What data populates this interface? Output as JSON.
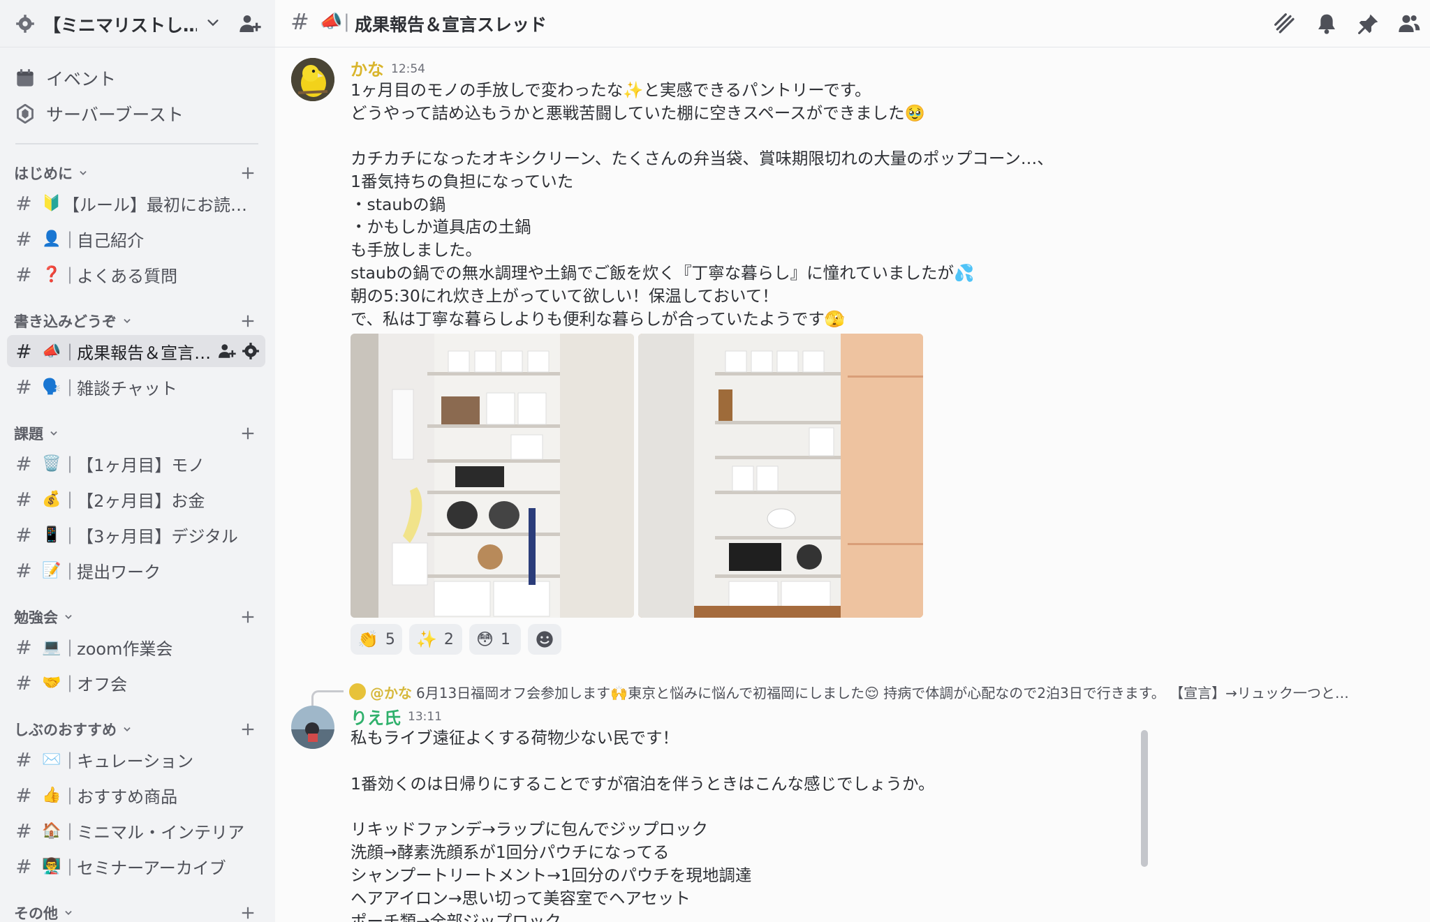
{
  "colors": {
    "sidebar_bg": "#f2f3f5",
    "main_bg": "#fbfbfb",
    "username_kana": "#d9b52c",
    "username_rie": "#2fb06b",
    "mention": "#d6b83b"
  },
  "server": {
    "name": "【ミニマリストし…"
  },
  "sidebar": {
    "top_items": [
      {
        "icon": "calendar-icon",
        "label": "イベント"
      },
      {
        "icon": "boost-icon",
        "label": "サーバーブースト"
      }
    ],
    "categories": [
      {
        "name": "はじめに",
        "channels": [
          {
            "emoji": "🔰",
            "label": "【ルール】最初にお読…"
          },
          {
            "emoji": "👤",
            "label": "自己紹介"
          },
          {
            "emoji": "❓",
            "label": "よくある質問"
          }
        ]
      },
      {
        "name": "書き込みどうぞ",
        "channels": [
          {
            "emoji": "📣",
            "label": "成果報告＆宣言…",
            "active": true
          },
          {
            "emoji": "🗣️",
            "label": "雑談チャット"
          }
        ]
      },
      {
        "name": "課題",
        "channels": [
          {
            "emoji": "🗑️",
            "label": "【1ヶ月目】モノ"
          },
          {
            "emoji": "💰",
            "label": "【2ヶ月目】お金"
          },
          {
            "emoji": "📱",
            "label": "【3ヶ月目】デジタル"
          },
          {
            "emoji": "📝",
            "label": "提出ワーク"
          }
        ]
      },
      {
        "name": "勉強会",
        "channels": [
          {
            "emoji": "💻",
            "label": "zoom作業会"
          },
          {
            "emoji": "🤝",
            "label": "オフ会"
          }
        ]
      },
      {
        "name": "しぶのおすすめ",
        "channels": [
          {
            "emoji": "✉️",
            "label": "キュレーション"
          },
          {
            "emoji": "👍",
            "label": "おすすめ商品"
          },
          {
            "emoji": "🏠",
            "label": "ミニマル・インテリア"
          },
          {
            "emoji": "👨‍🏫",
            "label": "セミナーアーカイブ"
          }
        ]
      },
      {
        "name": "その他",
        "channels": []
      }
    ]
  },
  "channel_header": {
    "emoji": "📣",
    "title": "成果報告＆宣言スレッド",
    "icons": [
      "threads-icon",
      "bell-icon",
      "pin-icon",
      "members-icon"
    ]
  },
  "messages": [
    {
      "author": "かな",
      "time": "12:54",
      "lines": [
        "1ヶ月目のモノの手放しで変わったな✨と実感できるパントリーです。",
        "どうやって詰め込もうかと悪戦苦闘していた棚に空きスペースができました🥹",
        "",
        "カチカチになったオキシクリーン、たくさんの弁当袋、賞味期限切れの大量のポップコーン…、",
        "1番気持ちの負担になっていた",
        "・staubの鍋",
        "・かもしか道具店の土鍋",
        "も手放しました。",
        "staubの鍋での無水調理や土鍋でご飯を炊く『丁寧な暮らし』に憧れていましたが💦",
        "朝の5:30にれ炊き上がっていて欲しい！保温しておいて！",
        "で、私は丁寧な暮らしよりも便利な暮らしが合っていたようです🫣"
      ],
      "reactions": [
        {
          "emoji": "👏",
          "count": "5"
        },
        {
          "emoji": "✨",
          "count": "2"
        },
        {
          "emoji": "😳",
          "count": "1"
        }
      ]
    },
    {
      "author": "りえ氏",
      "time": "13:11",
      "reply_to": {
        "mention": "@かな",
        "text": "6月13日福岡オフ会参加します🙌東京と悩みに悩んで初福岡にしました😌 持病で体調が心配なので2泊3日で行きます。 【宣言】→リュック一つと…"
      },
      "lines": [
        "私もライブ遠征よくする荷物少ない民です！",
        "",
        "1番効くのは日帰りにすることですが宿泊を伴うときはこんな感じでしょうか。",
        "",
        "リキッドファンデ→ラップに包んでジップロック",
        "洗顔→酵素洗顔系が1回分パウチになってる",
        "シャンプートリートメント→1回分のパウチを現地調達",
        "ヘアアイロン→思い切って美容室でヘアセット",
        "ポーチ類→全部ジップロック"
      ]
    }
  ]
}
